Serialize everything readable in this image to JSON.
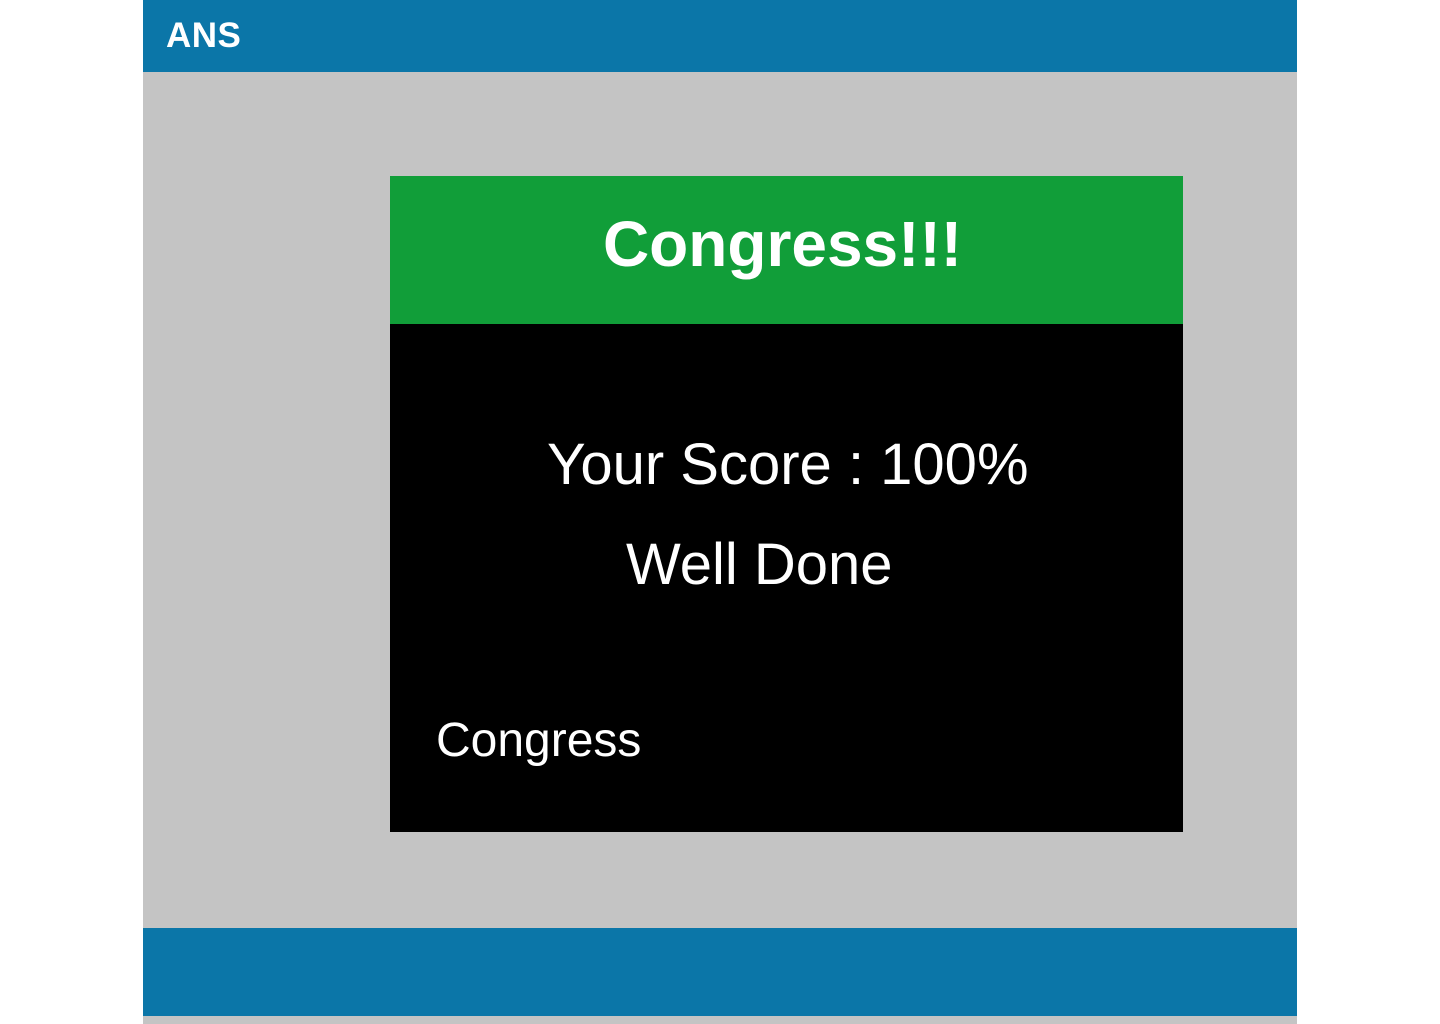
{
  "app": {
    "brand": "ANS"
  },
  "result_card": {
    "title": "Congress!!!",
    "score_label": "Your Score",
    "score_separator": " : ",
    "score_value": "100%",
    "message": "Well Done",
    "footnote": "Congress"
  },
  "colors": {
    "header_bg": "#0b76a8",
    "footer_bg": "#0b76a8",
    "page_bg": "#c4c4c4",
    "card_header_bg": "#119e39",
    "card_body_bg": "#000000",
    "text": "#ffffff"
  }
}
